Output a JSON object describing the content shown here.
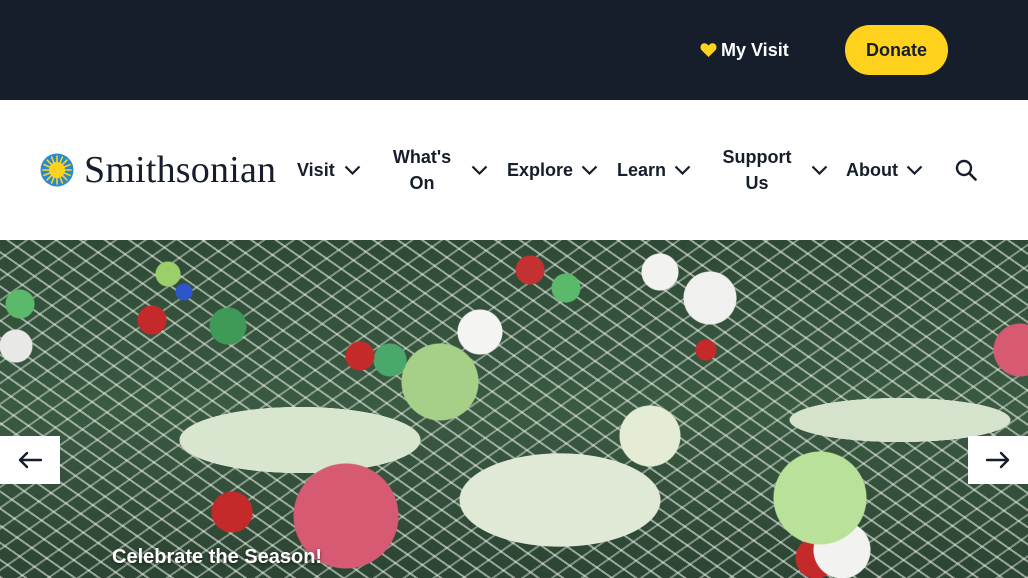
{
  "topbar": {
    "my_visit_label": "My Visit",
    "my_visit_icon": "heart-icon",
    "donate_label": "Donate"
  },
  "header": {
    "logo_text": "Smithsonian",
    "logo_icon": "sun-icon",
    "nav": [
      {
        "label": "Visit",
        "icon": "chevron-down-icon"
      },
      {
        "label": "What's On",
        "icon": "chevron-down-icon"
      },
      {
        "label": "Explore",
        "icon": "chevron-down-icon"
      },
      {
        "label": "Learn",
        "icon": "chevron-down-icon"
      },
      {
        "label": "Support Us",
        "icon": "chevron-down-icon"
      },
      {
        "label": "About",
        "icon": "chevron-down-icon"
      }
    ],
    "search_icon": "search-icon"
  },
  "hero": {
    "caption": "Celebrate the Season!",
    "prev_icon": "arrow-left-icon",
    "next_icon": "arrow-right-icon"
  },
  "colors": {
    "topbar_bg": "#161e2b",
    "accent_yellow": "#ffd21e",
    "text_dark": "#161e2b",
    "logo_sun": "#ffd21e",
    "logo_disc": "#2a8ad0"
  }
}
